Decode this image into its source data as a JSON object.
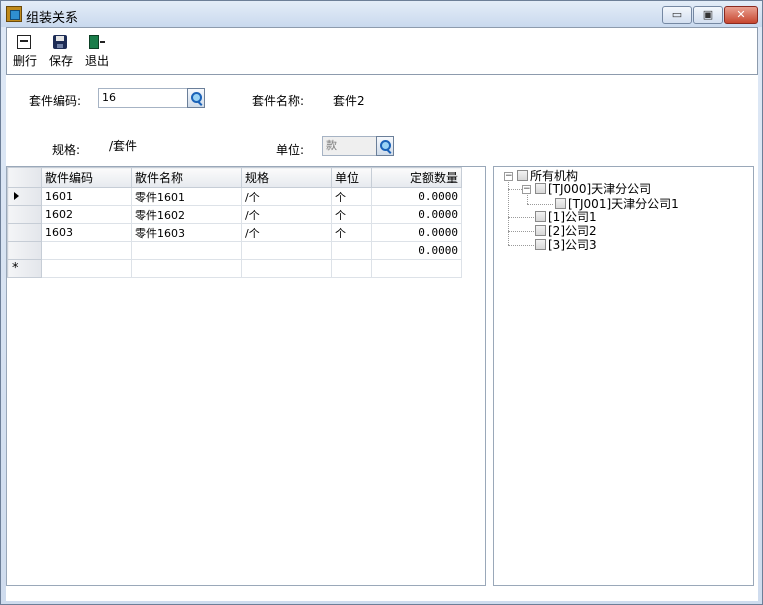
{
  "window": {
    "title": "组装关系",
    "min_symbol": "▭",
    "max_symbol": "▣",
    "close_symbol": "✕"
  },
  "toolbar": {
    "delete_row_label": "删行",
    "save_label": "保存",
    "exit_label": "退出"
  },
  "form": {
    "kit_code_label": "套件编码:",
    "kit_code_value": "16",
    "kit_name_label": "套件名称:",
    "kit_name_value": "套件2",
    "spec_label": "规格:",
    "spec_value": "/套件",
    "unit_label": "单位:",
    "unit_value": "款"
  },
  "grid": {
    "columns": [
      "散件编码",
      "散件名称",
      "规格",
      "单位",
      "定额数量"
    ],
    "rows": [
      {
        "code": "1601",
        "name": "零件1601",
        "spec": "/个",
        "unit": "个",
        "qty": "0.0000"
      },
      {
        "code": "1602",
        "name": "零件1602",
        "spec": "/个",
        "unit": "个",
        "qty": "0.0000"
      },
      {
        "code": "1603",
        "name": "零件1603",
        "spec": "/个",
        "unit": "个",
        "qty": "0.0000"
      },
      {
        "code": "",
        "name": "",
        "spec": "",
        "unit": "",
        "qty": "0.0000"
      }
    ],
    "new_row_marker": "*"
  },
  "tree": {
    "root": "所有机构",
    "nodes": [
      "[TJ000]天津分公司",
      "[TJ001]天津分公司1",
      "[1]公司1",
      "[2]公司2",
      "[3]公司3"
    ],
    "collapse_symbol": "−"
  }
}
